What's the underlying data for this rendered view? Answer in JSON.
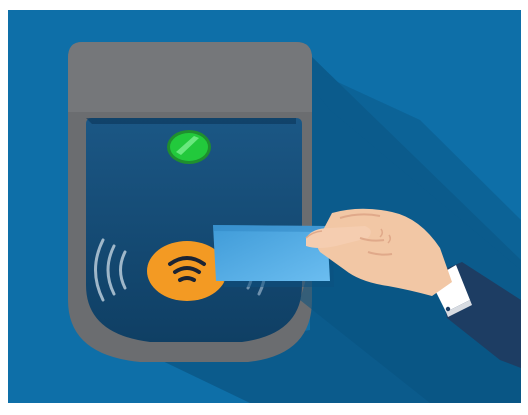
{
  "scene": {
    "subject": "",
    "status_light": "green",
    "reader_icon": "contactless-wifi-icon",
    "card": "blank-card"
  },
  "colors": {
    "background": "#0e6fa8",
    "shadow": "#0a5585",
    "reader_body": "#6b6b6b",
    "reader_screen": "#134a72",
    "status_green": "#22c93c",
    "nfc_orange": "#f39a23",
    "card_blue": "#4aa7e2",
    "sleeve": "#1d3d63",
    "skin": "#f2c7a5"
  }
}
